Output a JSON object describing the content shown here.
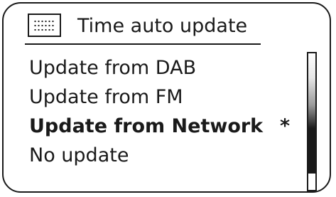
{
  "header": {
    "icon": "clock-settings-icon",
    "title": "Time auto update"
  },
  "menu": {
    "items": [
      {
        "label": "Update from DAB",
        "selected": false,
        "mark": ""
      },
      {
        "label": "Update from FM",
        "selected": false,
        "mark": ""
      },
      {
        "label": "Update from Network",
        "selected": true,
        "mark": "*"
      },
      {
        "label": "No update",
        "selected": false,
        "mark": ""
      }
    ]
  },
  "scrollbar": {
    "visible_fraction": 0.88
  },
  "colors": {
    "foreground": "#1a1a1a",
    "background": "#ffffff"
  }
}
